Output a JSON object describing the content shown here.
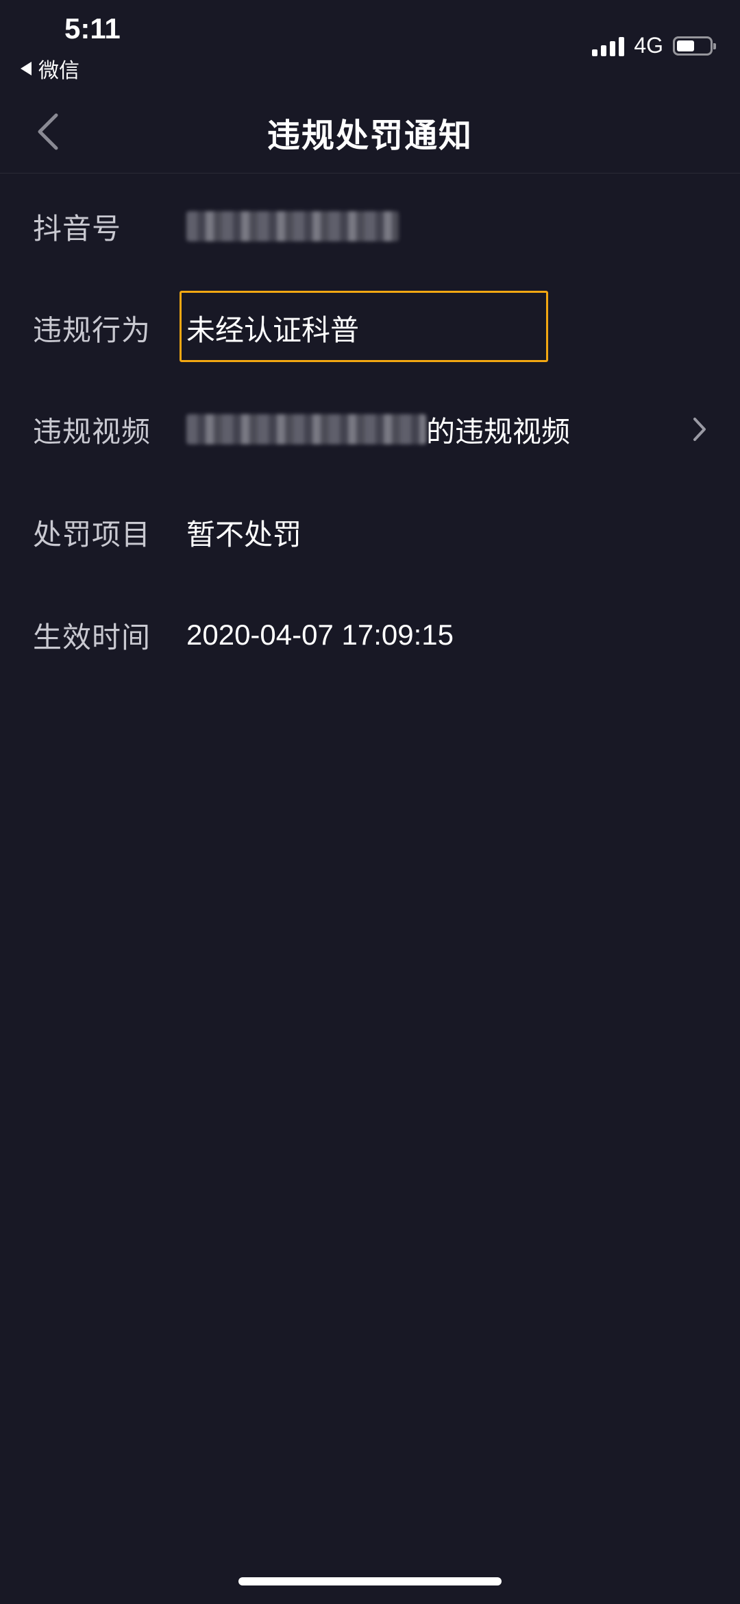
{
  "status_bar": {
    "time": "5:11",
    "back_app_label": "微信",
    "network": "4G",
    "battery_level": 0.55
  },
  "nav": {
    "title": "违规处罚通知"
  },
  "rows": [
    {
      "label": "抖音号",
      "value": "",
      "value_redacted": true
    },
    {
      "label": "违规行为",
      "value": "未经认证科普",
      "highlighted": true
    },
    {
      "label": "违规视频",
      "value_prefix_redacted": true,
      "value": "的违规视频",
      "has_chevron": true
    },
    {
      "label": "处罚项目",
      "value": "暂不处罚"
    },
    {
      "label": "生效时间",
      "value": "2020-04-07 17:09:15"
    }
  ],
  "colors": {
    "background": "#181825",
    "highlight_border": "#f2a712",
    "label": "#c9c9d1",
    "value": "#ffffff"
  }
}
